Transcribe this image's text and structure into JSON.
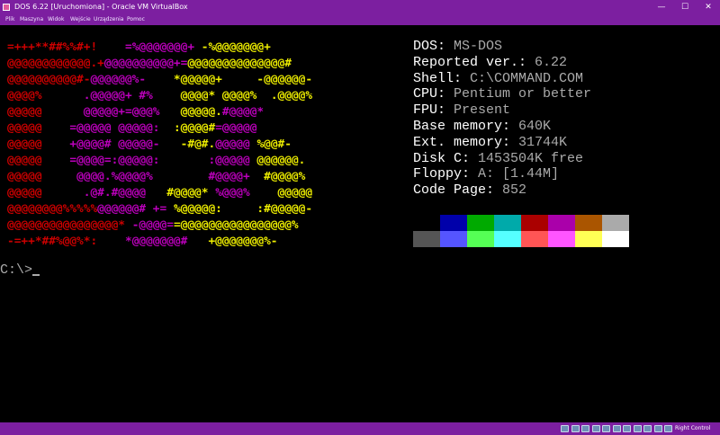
{
  "window": {
    "title": "DOS 6.22 [Uruchomiona] - Oracle VM VirtualBox",
    "controls": {
      "minimize": "—",
      "maximize": "☐",
      "close": "✕"
    }
  },
  "menu": [
    "Plik",
    "Maszyna",
    "Widok",
    "Wejście",
    "Urządzenia",
    "Pomoc"
  ],
  "logo_lines": [
    [
      {
        "t": "=+++**##%%#+!",
        "c": "#cc0000"
      },
      {
        "t": "    ",
        "c": "#000"
      },
      {
        "t": "=%@@@@@@@+",
        "c": "#bb00bb"
      },
      {
        "t": " ",
        "c": "#000"
      },
      {
        "t": "-%@@@@@@@+",
        "c": "#eeee00"
      }
    ],
    [
      {
        "t": "@@@@@@@@@@@@.+",
        "c": "#cc0000"
      },
      {
        "t": "@@@@@@@@@@+=",
        "c": "#bb00bb"
      },
      {
        "t": "@@@@@@@@@@@@@@#",
        "c": "#eeee00"
      }
    ],
    [
      {
        "t": "@@@@@@@@@@#-",
        "c": "#cc0000"
      },
      {
        "t": "@@@@@@%-",
        "c": "#bb00bb"
      },
      {
        "t": "    ",
        "c": "#000"
      },
      {
        "t": "*@@@@@+",
        "c": "#eeee00"
      },
      {
        "t": "     ",
        "c": "#000"
      },
      {
        "t": "-@@@@@@-",
        "c": "#eeee00"
      }
    ],
    [
      {
        "t": "@@@@%",
        "c": "#cc0000"
      },
      {
        "t": "      ",
        "c": "#000"
      },
      {
        "t": ".@@@@@+ #%",
        "c": "#bb00bb"
      },
      {
        "t": "    ",
        "c": "#000"
      },
      {
        "t": "@@@@* @@@@%",
        "c": "#eeee00"
      },
      {
        "t": "  ",
        "c": "#000"
      },
      {
        "t": ".@@@@%",
        "c": "#eeee00"
      }
    ],
    [
      {
        "t": "@@@@@",
        "c": "#cc0000"
      },
      {
        "t": "      ",
        "c": "#000"
      },
      {
        "t": "@@@@@+=@@@%",
        "c": "#bb00bb"
      },
      {
        "t": "   ",
        "c": "#000"
      },
      {
        "t": "@@@@@.",
        "c": "#eeee00"
      },
      {
        "t": "#@@@@*",
        "c": "#bb00bb"
      }
    ],
    [
      {
        "t": "@@@@@",
        "c": "#cc0000"
      },
      {
        "t": "    ",
        "c": "#000"
      },
      {
        "t": "=@@@@@ @@@@@:",
        "c": "#bb00bb"
      },
      {
        "t": "  ",
        "c": "#000"
      },
      {
        "t": ":@@@@#",
        "c": "#eeee00"
      },
      {
        "t": "=@@@@@",
        "c": "#bb00bb"
      }
    ],
    [
      {
        "t": "@@@@@",
        "c": "#cc0000"
      },
      {
        "t": "    ",
        "c": "#000"
      },
      {
        "t": "+@@@@# @@@@@-",
        "c": "#bb00bb"
      },
      {
        "t": "   ",
        "c": "#000"
      },
      {
        "t": "-#@#.",
        "c": "#eeee00"
      },
      {
        "t": "@@@@@",
        "c": "#bb00bb"
      },
      {
        "t": " ",
        "c": "#000"
      },
      {
        "t": "%@@#-",
        "c": "#eeee00"
      }
    ],
    [
      {
        "t": "@@@@@",
        "c": "#cc0000"
      },
      {
        "t": "    ",
        "c": "#000"
      },
      {
        "t": "=@@@@=:@@@@@:",
        "c": "#bb00bb"
      },
      {
        "t": "       ",
        "c": "#000"
      },
      {
        "t": ":@@@@@",
        "c": "#bb00bb"
      },
      {
        "t": " ",
        "c": "#000"
      },
      {
        "t": "@@@@@@.",
        "c": "#eeee00"
      }
    ],
    [
      {
        "t": "@@@@@",
        "c": "#cc0000"
      },
      {
        "t": "     ",
        "c": "#000"
      },
      {
        "t": "@@@@.%@@@@%",
        "c": "#bb00bb"
      },
      {
        "t": "        ",
        "c": "#000"
      },
      {
        "t": "#@@@@+",
        "c": "#bb00bb"
      },
      {
        "t": "  ",
        "c": "#000"
      },
      {
        "t": "#@@@@%",
        "c": "#eeee00"
      }
    ],
    [
      {
        "t": "@@@@@",
        "c": "#cc0000"
      },
      {
        "t": "      ",
        "c": "#000"
      },
      {
        "t": ".@#.#@@@@",
        "c": "#bb00bb"
      },
      {
        "t": "   ",
        "c": "#000"
      },
      {
        "t": "#@@@@*",
        "c": "#eeee00"
      },
      {
        "t": " ",
        "c": "#000"
      },
      {
        "t": "%@@@%",
        "c": "#bb00bb"
      },
      {
        "t": "    ",
        "c": "#000"
      },
      {
        "t": "@@@@@",
        "c": "#eeee00"
      }
    ],
    [
      {
        "t": "@@@@@@@@%%%%%",
        "c": "#cc0000"
      },
      {
        "t": "@@@@@@# +=",
        "c": "#bb00bb"
      },
      {
        "t": " ",
        "c": "#000"
      },
      {
        "t": "%@@@@@:",
        "c": "#eeee00"
      },
      {
        "t": "     ",
        "c": "#000"
      },
      {
        "t": ":#@@@@@-",
        "c": "#eeee00"
      }
    ],
    [
      {
        "t": "@@@@@@@@@@@@@@@@*",
        "c": "#cc0000"
      },
      {
        "t": " ",
        "c": "#000"
      },
      {
        "t": "-@@@@=",
        "c": "#bb00bb"
      },
      {
        "t": "=@@@@@@@@@@@@@@@@%",
        "c": "#eeee00"
      }
    ],
    [
      {
        "t": "-=++*##%@@%*:",
        "c": "#cc0000"
      },
      {
        "t": "    ",
        "c": "#000"
      },
      {
        "t": "*@@@@@@@#",
        "c": "#bb00bb"
      },
      {
        "t": "   ",
        "c": "#000"
      },
      {
        "t": "+@@@@@@@%-",
        "c": "#eeee00"
      }
    ]
  ],
  "system_info": [
    {
      "label": "DOS:",
      "value": "MS-DOS"
    },
    {
      "label": "Reported ver.:",
      "value": "6.22"
    },
    {
      "label": "Shell:",
      "value": "C:\\COMMAND.COM"
    },
    {
      "label": "CPU:",
      "value": "Pentium or better"
    },
    {
      "label": "FPU:",
      "value": "Present"
    },
    {
      "label": "Base memory:",
      "value": "640K"
    },
    {
      "label": "Ext. memory:",
      "value": "31744K"
    },
    {
      "label": "Disk C:",
      "value": "1453504K free"
    },
    {
      "label": "Floppy:",
      "value": "A: [1.44M]"
    },
    {
      "label": "Code Page:",
      "value": "852"
    }
  ],
  "palette": {
    "top": [
      "#000000",
      "#0000aa",
      "#00aa00",
      "#00aaaa",
      "#aa0000",
      "#aa00aa",
      "#aa5500",
      "#aaaaaa"
    ],
    "bottom": [
      "#555555",
      "#5555ff",
      "#55ff55",
      "#55ffff",
      "#ff5555",
      "#ff55ff",
      "#ffff55",
      "#ffffff"
    ]
  },
  "prompt": "C:\\>",
  "statusbar": {
    "host_key": "Right Control",
    "icons": [
      "hard-disk-icon",
      "optical-drive-icon",
      "audio-icon",
      "network-icon",
      "usb-icon",
      "shared-folders-icon",
      "display-icon",
      "video-capture-icon",
      "cpu-icon",
      "mouse-integration-icon",
      "keyboard-icon"
    ]
  }
}
